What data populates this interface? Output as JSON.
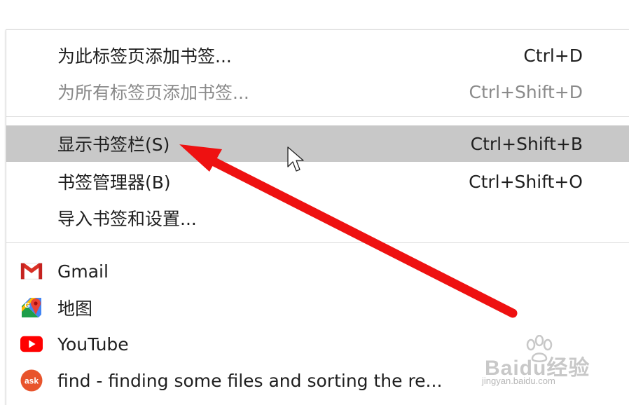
{
  "menu": {
    "bookmark_tab": {
      "label": "为此标签页添加书签...",
      "shortcut": "Ctrl+D"
    },
    "bookmark_all_tabs": {
      "label": "为所有标签页添加书签...",
      "shortcut": "Ctrl+Shift+D"
    },
    "show_bookmarks_bar": {
      "label": "显示书签栏(S)",
      "shortcut": "Ctrl+Shift+B"
    },
    "bookmark_manager": {
      "label": "书签管理器(B)",
      "shortcut": "Ctrl+Shift+O"
    },
    "import_bookmarks": {
      "label": "导入书签和设置..."
    },
    "bookmarks": [
      {
        "label": "Gmail",
        "icon": "gmail-icon"
      },
      {
        "label": "地图",
        "icon": "maps-icon"
      },
      {
        "label": "YouTube",
        "icon": "youtube-icon"
      },
      {
        "label": "find - finding some files and sorting the re...",
        "icon": "ask-icon",
        "icon_text": "ask"
      }
    ]
  },
  "colors": {
    "highlight": "#c8c8c8",
    "disabled_text": "#8a8a8a",
    "arrow": "#ee1111"
  },
  "watermark": {
    "text": "Baidu经验",
    "url": "jingyan.baidu.com"
  }
}
